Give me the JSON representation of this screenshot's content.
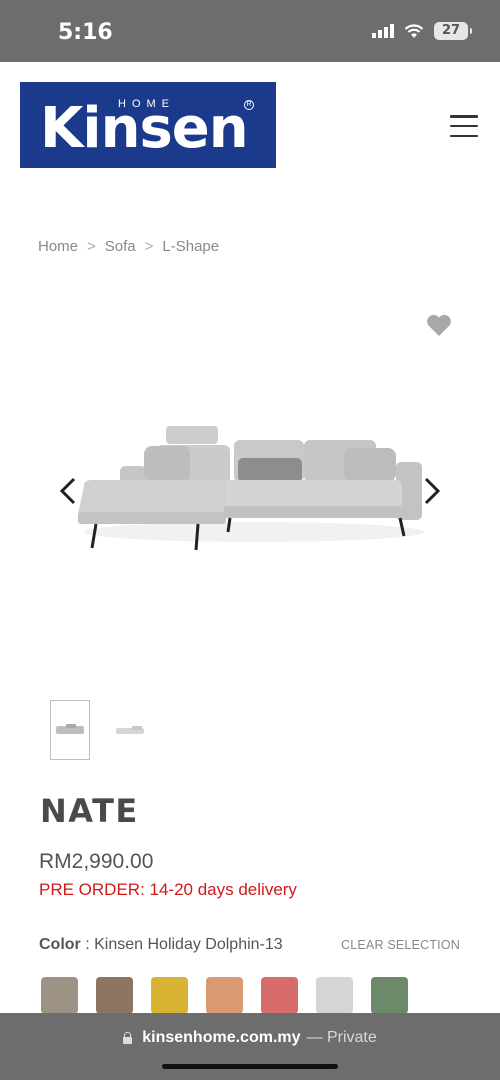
{
  "status_bar": {
    "time": "5:16",
    "battery": "27"
  },
  "header": {
    "logo_home": "HOME",
    "logo_brand": "Kinsen",
    "logo_reg": "R"
  },
  "breadcrumb": [
    {
      "label": "Home"
    },
    {
      "label": "Sofa"
    },
    {
      "label": "L-Shape"
    }
  ],
  "breadcrumb_separator": ">",
  "gallery": {
    "thumbnail_count": 2,
    "active_thumbnail": 1
  },
  "product": {
    "name": "NATE",
    "price": "RM2,990.00",
    "preorder": "PRE ORDER: 14-20 days delivery",
    "color_label": "Color",
    "color_value": "Kinsen Holiday Dolphin-13",
    "clear_selection": "CLEAR SELECTION",
    "swatches": [
      {
        "color": "#9d9384"
      },
      {
        "color": "#8d7561"
      },
      {
        "color": "#d9b434"
      },
      {
        "color": "#d99a72"
      },
      {
        "color": "#d86b6b"
      },
      {
        "color": "#d5d5d5"
      },
      {
        "color": "#6c8a6a"
      }
    ]
  },
  "browser": {
    "domain": "kinsenhome.com.my",
    "mode": "— Private"
  },
  "colors": {
    "status_bar": "#6d6d6d",
    "brand_blue": "#1b3a8c",
    "preorder_red": "#d21818"
  }
}
